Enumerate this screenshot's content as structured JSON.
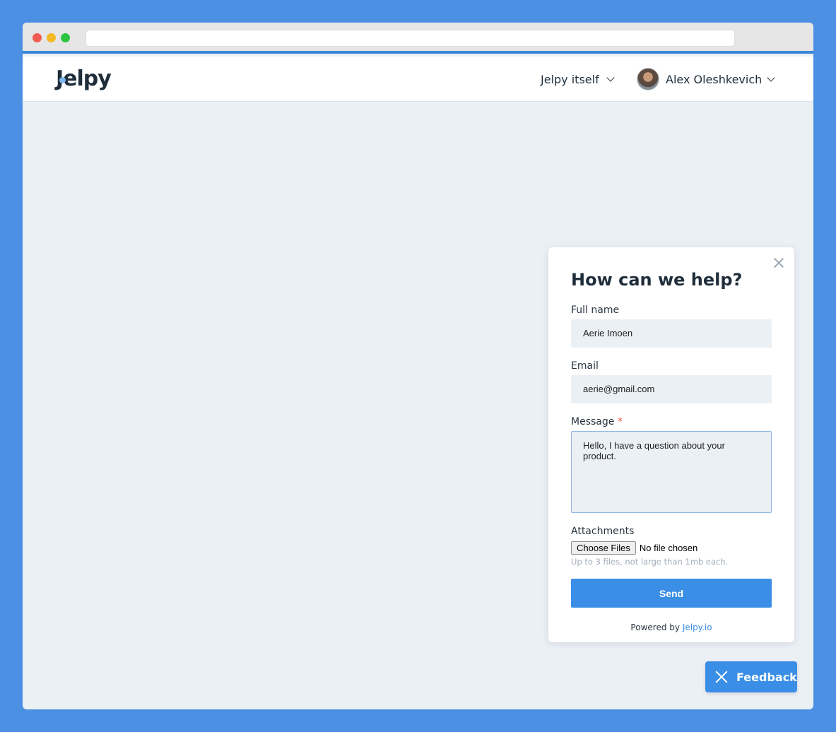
{
  "browser": {
    "address": ""
  },
  "header": {
    "logo": "Jelpy",
    "workspace": "Jelpy itself",
    "user_name": "Alex Oleshkevich"
  },
  "form": {
    "title": "How can we help?",
    "full_name_label": "Full name",
    "full_name_value": "Aerie Imoen",
    "email_label": "Email",
    "email_value": "aerie@gmail.com",
    "message_label": "Message",
    "required_mark": "*",
    "message_value": "Hello, I have a question about your product.",
    "attachments_label": "Attachments",
    "choose_files_label": "Choose Files",
    "no_file_text": "No file chosen",
    "attachments_hint": "Up to 3 files, not large than 1mb each.",
    "send_label": "Send",
    "powered_by": "Powered by",
    "powered_link": "Jelpy.io"
  },
  "feedback_button": {
    "label": "Feedback"
  },
  "colors": {
    "accent": "#3a8ee6",
    "background": "#4b90e2",
    "page": "#ebf0f5"
  }
}
